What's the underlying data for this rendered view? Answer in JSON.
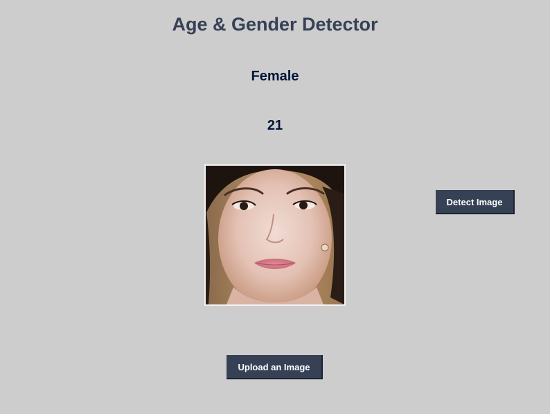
{
  "app": {
    "title": "Age & Gender Detector"
  },
  "result": {
    "gender": "Female",
    "age": "21"
  },
  "buttons": {
    "detect_label": "Detect Image",
    "upload_label": "Upload an Image"
  },
  "colors": {
    "background": "#cdcdcd",
    "title": "#364156",
    "result_text": "#011638",
    "button_bg": "#364156",
    "button_text": "#ffffff"
  },
  "icons": {
    "preview": "face-photo"
  }
}
